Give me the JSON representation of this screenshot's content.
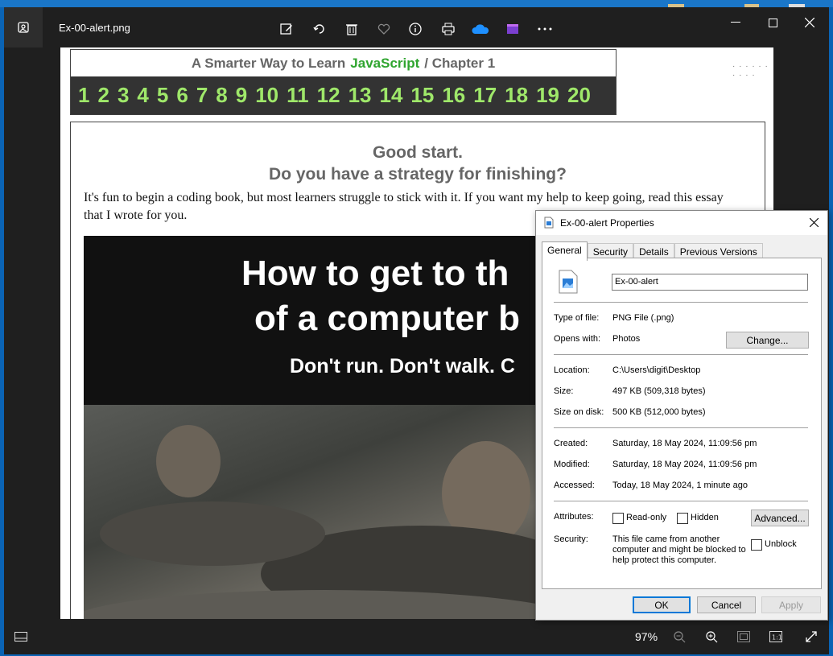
{
  "viewer": {
    "filename": "Ex-00-alert.png",
    "zoom": "97%"
  },
  "page": {
    "book_title_pre": "A Smarter Way to Learn",
    "book_title_js": "JavaScript",
    "book_title_post": "/  Chapter 1",
    "chapters": [
      "1",
      "2",
      "3",
      "4",
      "5",
      "6",
      "7",
      "8",
      "9",
      "10",
      "11",
      "12",
      "13",
      "14",
      "15",
      "16",
      "17",
      "18",
      "19",
      "20"
    ],
    "heading1": "Good start.",
    "heading2": "Do you have a strategy for finishing?",
    "intro": "It's fun to begin a coding book, but most learners struggle to stick with it. If you want my help to keep going, read this essay that I wrote for you.",
    "banner_line1": "How to get to th",
    "banner_line2": "of a computer b",
    "banner_line3": "Don't run. Don't walk. C"
  },
  "dialog": {
    "title": "Ex-00-alert Properties",
    "tabs": [
      "General",
      "Security",
      "Details",
      "Previous Versions"
    ],
    "name_value": "Ex-00-alert",
    "type_label": "Type of file:",
    "type_value": "PNG File (.png)",
    "opens_label": "Opens with:",
    "opens_value": "Photos",
    "change_button": "Change...",
    "location_label": "Location:",
    "location_value": "C:\\Users\\digit\\Desktop",
    "size_label": "Size:",
    "size_value": "497 KB (509,318 bytes)",
    "size_disk_label": "Size on disk:",
    "size_disk_value": "500 KB (512,000 bytes)",
    "created_label": "Created:",
    "created_value": "Saturday, 18 May 2024, 11:09:56 pm",
    "modified_label": "Modified:",
    "modified_value": "Saturday, 18 May 2024, 11:09:56 pm",
    "accessed_label": "Accessed:",
    "accessed_value": "Today, 18 May 2024, 1 minute ago",
    "attributes_label": "Attributes:",
    "readonly_label": "Read-only",
    "hidden_label": "Hidden",
    "advanced_button": "Advanced...",
    "security_label": "Security:",
    "security_text_1": "This file came from another",
    "security_text_2": "computer and might be blocked to",
    "security_text_3": "help protect this computer.",
    "unblock_label": "Unblock",
    "ok_button": "OK",
    "cancel_button": "Cancel",
    "apply_button": "Apply"
  }
}
